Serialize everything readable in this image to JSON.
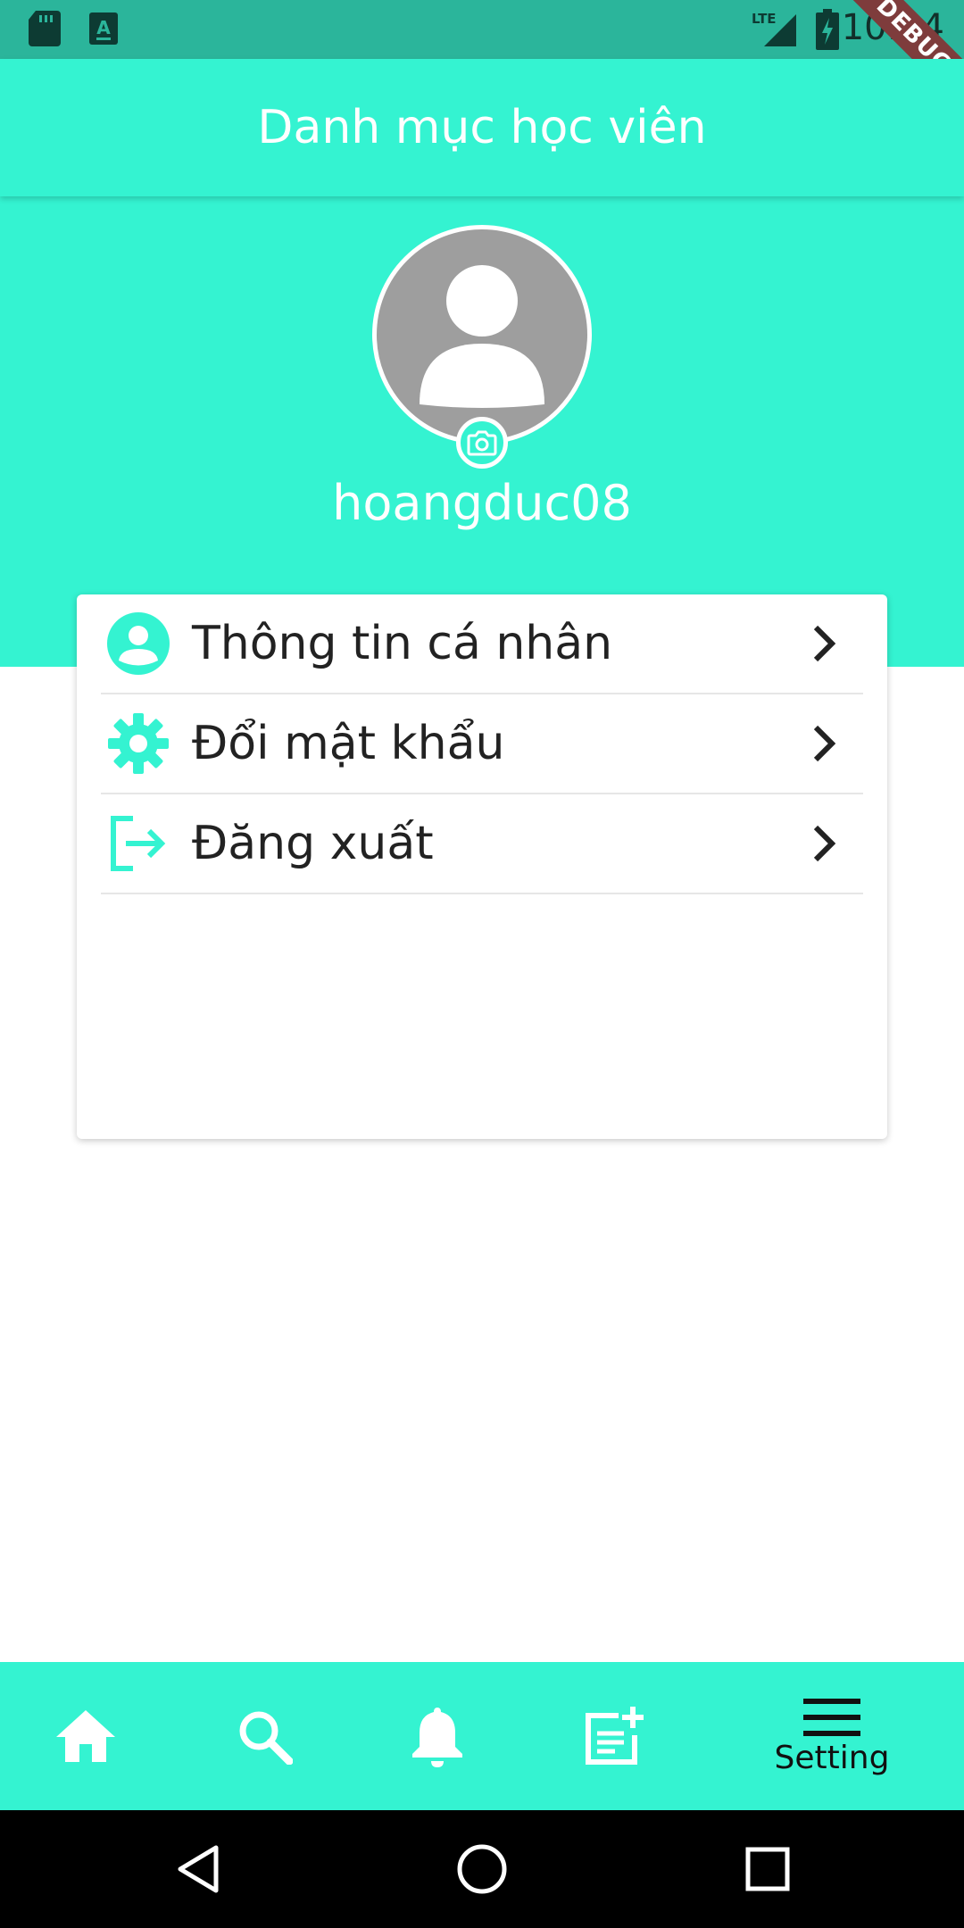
{
  "status_bar": {
    "time": "10:14",
    "network": "LTE",
    "debug_label": "DEBUG",
    "icons": [
      "sd-card-icon",
      "keyboard-a-icon",
      "signal-icon",
      "battery-charging-icon"
    ]
  },
  "app_bar": {
    "title": "Danh mục học viên"
  },
  "profile": {
    "username": "hoangduc08",
    "avatar_icon": "person-icon",
    "camera_icon": "camera-icon"
  },
  "menu": {
    "items": [
      {
        "label": "Thông tin cá nhân",
        "icon": "account-circle-icon"
      },
      {
        "label": "Đổi mật khẩu",
        "icon": "gear-icon"
      },
      {
        "label": "Đăng xuất",
        "icon": "logout-icon"
      }
    ],
    "chevron_icon": "chevron-right-icon"
  },
  "bottom_nav": {
    "items": [
      {
        "icon": "home-icon",
        "label": ""
      },
      {
        "icon": "search-icon",
        "label": ""
      },
      {
        "icon": "bell-icon",
        "label": ""
      },
      {
        "icon": "post-add-icon",
        "label": ""
      },
      {
        "icon": "menu-icon",
        "label": "Setting",
        "selected": true
      }
    ]
  },
  "colors": {
    "accent": "#34f3d1",
    "status_bar": "#2bb59b",
    "avatar_bg": "#9e9e9e",
    "text_dark": "#222222"
  }
}
